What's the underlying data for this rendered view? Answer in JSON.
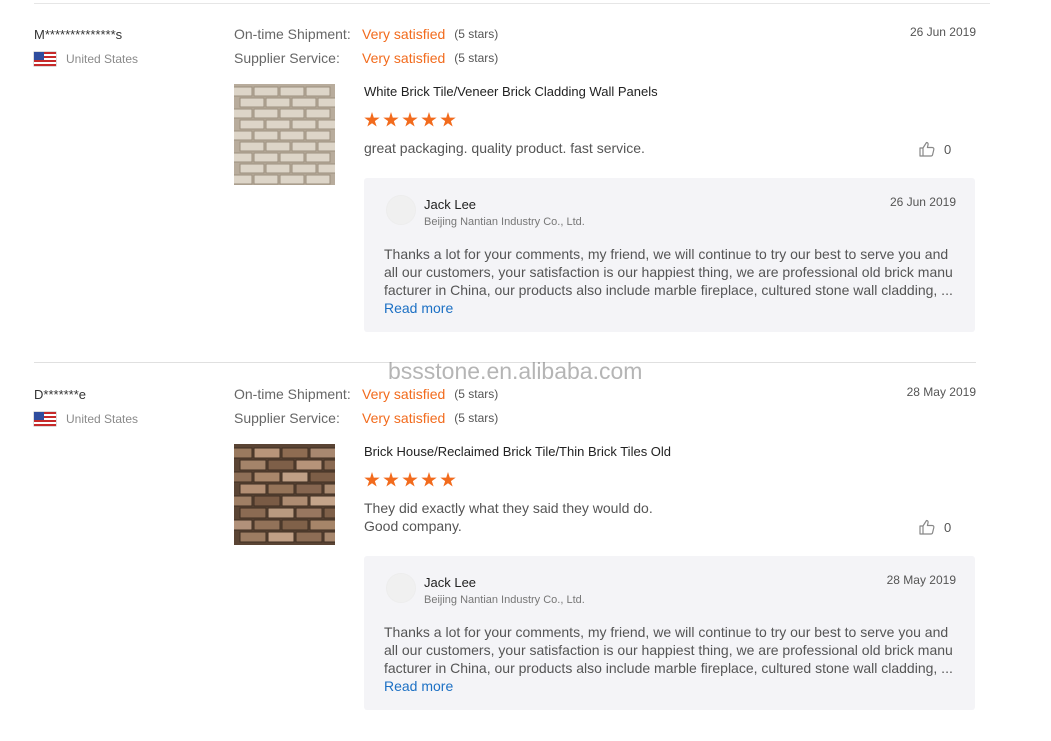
{
  "watermark": "bssstone.en.alibaba.com",
  "colors": {
    "accent": "#f26b1d",
    "link": "#1c70c4",
    "reply_bg": "#f4f4f7"
  },
  "icons": {
    "like": "thumbs-up-icon",
    "flag": "us-flag-icon",
    "star": "star-icon"
  },
  "reviews": [
    {
      "buyer": "M**************s",
      "country": "United States",
      "shipment_label": "On-time Shipment:",
      "shipment_value": "Very satisfied",
      "shipment_stars": "(5 stars)",
      "service_label": "Supplier Service:",
      "service_value": "Very satisfied",
      "service_stars": "(5 stars)",
      "date": "26 Jun 2019",
      "product": "White Brick Tile/Veneer Brick Cladding Wall Panels",
      "rating": 5,
      "comment": "great packaging. quality product. fast service.",
      "likes": "0",
      "reply": {
        "name": "Jack Lee",
        "company": "Beijing Nantian Industry Co., Ltd.",
        "date": "26 Jun 2019",
        "text": "Thanks a lot for your comments, my friend, we will continue to try our best to serve you and all our customers, your satisfaction is our happiest thing, we are professional old brick manufacturer in China, our products also include marble fireplace, cultured stone wall cladding, ...",
        "read_more": "Read more"
      }
    },
    {
      "buyer": "D*******e",
      "country": "United States",
      "shipment_label": "On-time Shipment:",
      "shipment_value": "Very satisfied",
      "shipment_stars": "(5 stars)",
      "service_label": "Supplier Service:",
      "service_value": "Very satisfied",
      "service_stars": "(5 stars)",
      "date": "28 May 2019",
      "product": "Brick House/Reclaimed Brick Tile/Thin Brick Tiles Old",
      "rating": 5,
      "comment_line1": "They did exactly what they said they would do.",
      "comment_line2": "Good company.",
      "likes": "0",
      "reply": {
        "name": "Jack Lee",
        "company": "Beijing Nantian Industry Co., Ltd.",
        "date": "28 May 2019",
        "text": "Thanks a lot for your comments, my friend, we will continue to try our best to serve you and all our customers, your satisfaction is our happiest thing, we are professional old brick manufacturer in China, our products also include marble fireplace, cultured stone wall cladding, ...",
        "read_more": "Read more"
      }
    }
  ]
}
